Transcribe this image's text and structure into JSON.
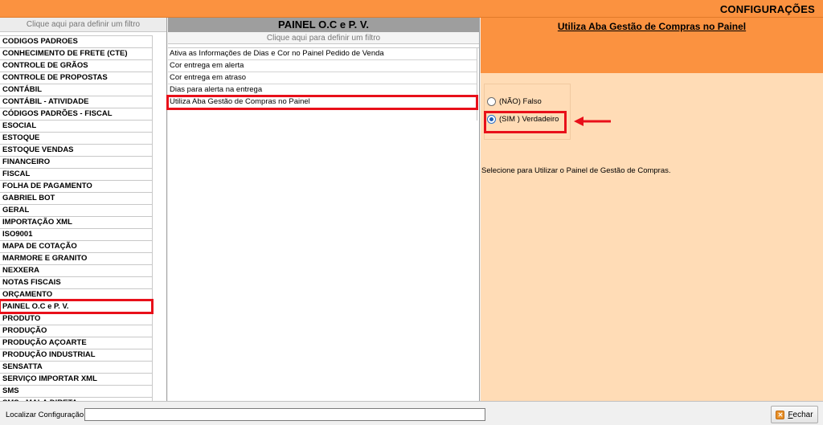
{
  "window": {
    "title": "CONFIGURAÇÕES"
  },
  "left_panel": {
    "filter_text": "Clique aqui para definir um filtro",
    "items": [
      "CODIGOS PADROES",
      "CONHECIMENTO DE FRETE (CTE)",
      "CONTROLE DE GRÃOS",
      "CONTROLE DE PROPOSTAS",
      "CONTÁBIL",
      "CONTÁBIL - ATIVIDADE",
      "CÓDIGOS PADRÕES - FISCAL",
      "ESOCIAL",
      "ESTOQUE",
      "ESTOQUE VENDAS",
      "FINANCEIRO",
      "FISCAL",
      "FOLHA DE PAGAMENTO",
      "GABRIEL BOT",
      "GERAL",
      "IMPORTAÇÃO XML",
      "ISO9001",
      "MAPA DE COTAÇÃO",
      "MARMORE E GRANITO",
      "NEXXERA",
      "NOTAS FISCAIS",
      "ORÇAMENTO",
      "PAINEL O.C e P. V.",
      "PRODUTO",
      "PRODUÇÃO",
      "PRODUÇÃO AÇOARTE",
      "PRODUÇÃO INDUSTRIAL",
      "SENSATTA",
      "SERVIÇO IMPORTAR XML",
      "SMS",
      "SMS - MALA DIRETA"
    ],
    "selected_index": 22
  },
  "middle_panel": {
    "header": "PAINEL O.C e P. V.",
    "filter_text": "Clique aqui para definir um filtro",
    "rows": [
      "Ativa as Informações de Dias e Cor no Painel Pedido de Venda",
      "Cor entrega em alerta",
      "Cor entrega em atraso",
      "Dias para alerta na entrega",
      "Utiliza Aba Gestão de Compras no Painel"
    ],
    "selected_index": 4
  },
  "right_panel": {
    "title": "Utiliza Aba Gestão de Compras no Painel",
    "options": [
      {
        "label": "(NÃO) Falso",
        "checked": false
      },
      {
        "label": "(SIM ) Verdadeiro",
        "checked": true
      }
    ],
    "description": "Selecione para Utilizar o Painel de Gestão de Compras."
  },
  "bottom_bar": {
    "search_label": "Localizar Configuração:",
    "search_value": "",
    "close_button": {
      "label_first": "F",
      "label_rest": "echar"
    }
  },
  "colors": {
    "accent_orange": "#fb9240",
    "panel_peach": "#ffdcb6",
    "highlight_red": "#e8101a"
  }
}
